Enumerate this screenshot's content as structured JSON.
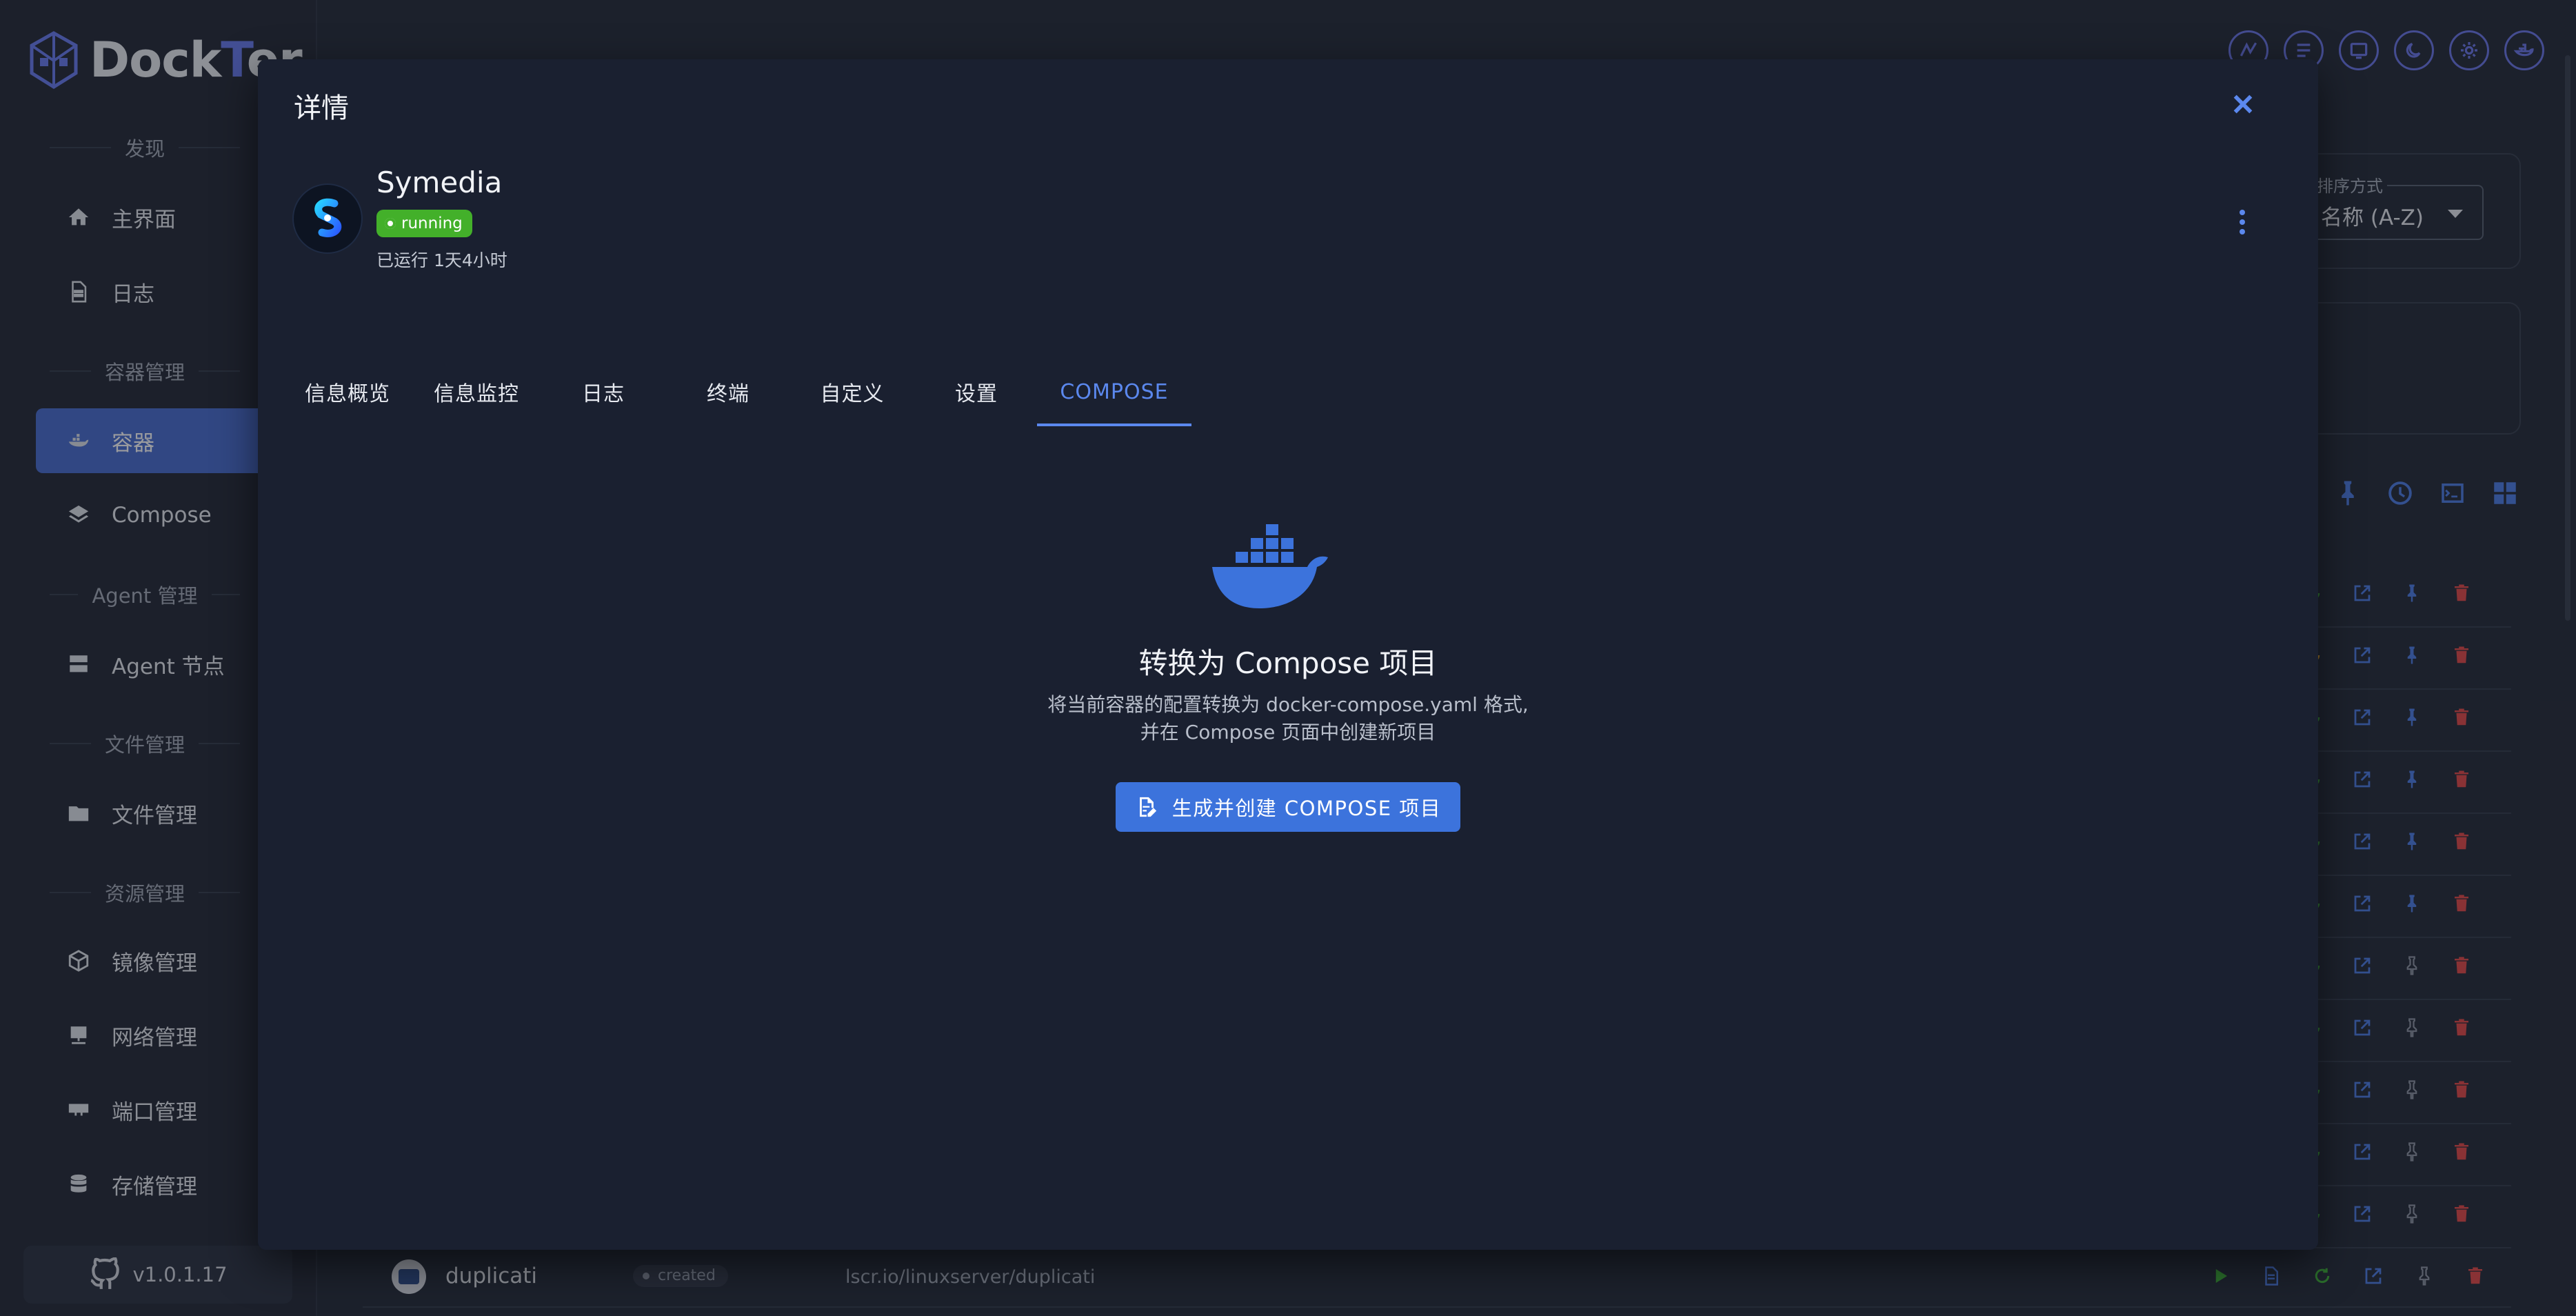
{
  "app": {
    "logo_prefix": "Dock",
    "logo_accent": "T",
    "logo_suffix": "er",
    "version": "v1.0.1.17"
  },
  "sidebar": {
    "sections": [
      "发现",
      "容器管理",
      "Agent 管理",
      "文件管理",
      "资源管理"
    ],
    "items": [
      {
        "label": "主界面",
        "icon": "home-icon"
      },
      {
        "label": "日志",
        "icon": "document-icon"
      },
      {
        "label": "容器",
        "icon": "whale-icon",
        "active": true
      },
      {
        "label": "Compose",
        "icon": "layers-icon"
      },
      {
        "label": "Agent 节点",
        "icon": "server-icon"
      },
      {
        "label": "文件管理",
        "icon": "folder-icon"
      },
      {
        "label": "镜像管理",
        "icon": "cube-icon"
      },
      {
        "label": "网络管理",
        "icon": "network-icon"
      },
      {
        "label": "端口管理",
        "icon": "port-icon"
      },
      {
        "label": "存储管理",
        "icon": "database-icon"
      }
    ]
  },
  "toolbar": {
    "sort_label": "排序方式",
    "sort_value": "名称 (A-Z)"
  },
  "background_row": {
    "name": "duplicati",
    "status": "created",
    "image": "lscr.io/linuxserver/duplicati"
  },
  "dialog": {
    "title": "详情",
    "container_name": "Symedia",
    "status": "running",
    "uptime": "已运行 1天4小时",
    "tabs": [
      "信息概览",
      "信息监控",
      "日志",
      "终端",
      "自定义",
      "设置",
      "COMPOSE"
    ],
    "active_tab": "COMPOSE",
    "compose": {
      "title": "转换为 Compose 项目",
      "desc_line1": "将当前容器的配置转换为 docker-compose.yaml 格式,",
      "desc_line2": "并在 Compose 页面中创建新项目",
      "button_label": "生成并创建 COMPOSE 项目"
    }
  },
  "colors": {
    "accent": "#5b88ee",
    "running": "#43b02a",
    "sidebar_active": "#4a6fd1",
    "danger": "#e24a4a"
  }
}
